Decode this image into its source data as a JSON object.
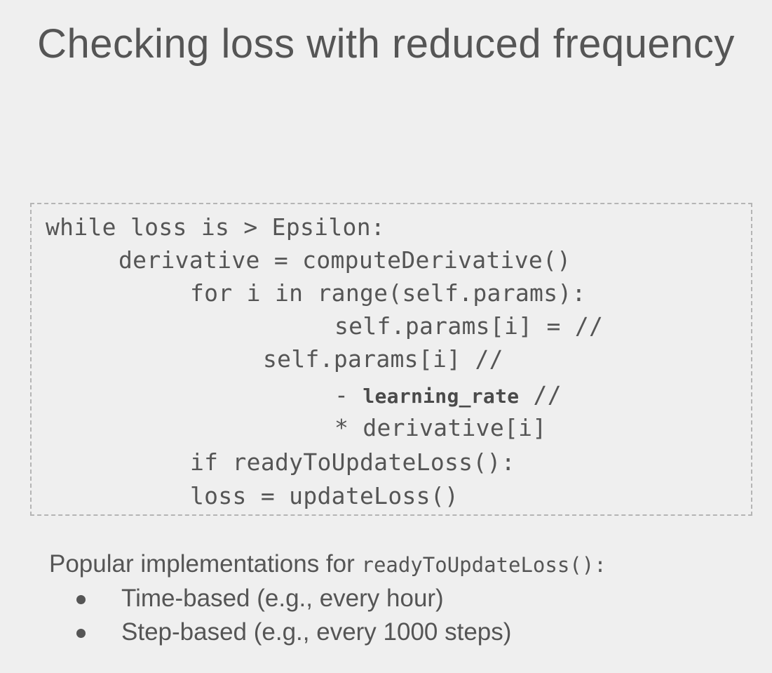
{
  "slide": {
    "title": "Checking loss with reduced frequency"
  },
  "code": {
    "line1": "while loss is > Epsilon:",
    "line2": "derivative = computeDerivative()",
    "line3": "for i in range(self.params):",
    "line4": "self.params[i] = //",
    "line5": "self.params[i] //",
    "line6_prefix": "- ",
    "line6_bold": "learning_rate",
    "line6_suffix": " //",
    "line7": "* derivative[i]",
    "line8": "if readyToUpdateLoss():",
    "line9": "loss = updateLoss()"
  },
  "notes": {
    "heading_text": "Popular implementations for ",
    "heading_code": "readyToUpdateLoss():",
    "bullets": [
      "Time-based (e.g., every hour)",
      "Step-based (e.g., every 1000 steps)"
    ]
  }
}
